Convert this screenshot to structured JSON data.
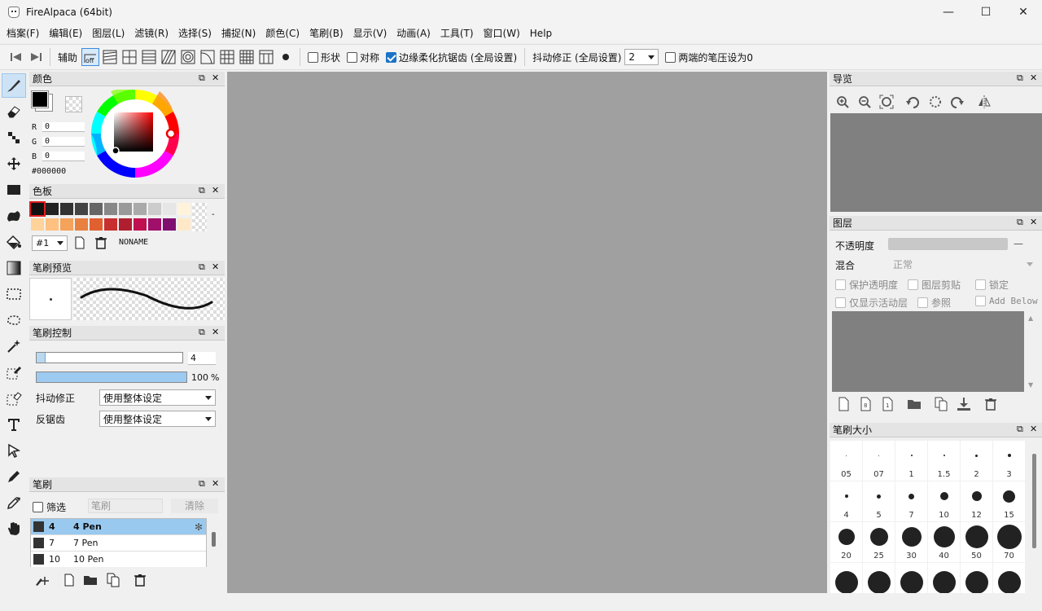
{
  "window": {
    "title": "FireAlpaca (64bit)",
    "minimize": "—",
    "maximize": "☐",
    "close": "✕"
  },
  "menu": [
    "档案(F)",
    "编辑(E)",
    "图层(L)",
    "滤镜(R)",
    "选择(S)",
    "捕捉(N)",
    "颜色(C)",
    "笔刷(B)",
    "显示(V)",
    "动画(A)",
    "工具(T)",
    "窗口(W)",
    "Help"
  ],
  "toolbar": {
    "assist_label": "辅助",
    "snap_off_label": "off",
    "shape_label": "形状",
    "symmetry_label": "对称",
    "antialias_label": "边缘柔化抗锯齿 (全局设置)",
    "antialias_checked": true,
    "stabilizer_label": "抖动修正 (全局设置)",
    "stabilizer_value": "2",
    "pressure_label": "两端的笔压设为0"
  },
  "color_panel": {
    "title": "颜色",
    "r_label": "R",
    "r_value": "0",
    "g_label": "G",
    "g_value": "0",
    "b_label": "B",
    "b_value": "0",
    "hex": "#000000"
  },
  "palette_panel": {
    "title": "色板",
    "palette_select": "#1",
    "palette_name": "NONAME",
    "row1": [
      "#111111",
      "#222222",
      "#333333",
      "#444444",
      "#666666",
      "#888888",
      "#999999",
      "#aaaaaa",
      "#cccccc",
      "#e6e6e6",
      "#fff3dc"
    ],
    "row2": [
      "#ffd39a",
      "#ffc080",
      "#f5a25a",
      "#e88040",
      "#e06030",
      "#c83030",
      "#b01f30",
      "#c01050",
      "#a0106a",
      "#801070",
      "#ffe8c8"
    ],
    "dash": "-"
  },
  "brush_preview_panel": {
    "title": "笔刷预览"
  },
  "brush_control_panel": {
    "title": "笔刷控制",
    "size_value": "4",
    "opacity_value": "100",
    "opacity_unit": "%",
    "size_fraction": 0.06,
    "opacity_fraction": 1.0,
    "stabilizer_label": "抖动修正",
    "stabilizer_value": "使用整体设定",
    "antialias_label": "反锯齿",
    "antialias_value": "使用整体设定"
  },
  "brush_panel": {
    "title": "笔刷",
    "filter_label": "筛选",
    "filter_placeholder": "笔刷",
    "clear_label": "清除",
    "items": [
      {
        "size": "4",
        "name": "4 Pen",
        "selected": true
      },
      {
        "size": "7",
        "name": "7 Pen",
        "selected": false
      },
      {
        "size": "10",
        "name": "10 Pen",
        "selected": false
      }
    ]
  },
  "navigator_panel": {
    "title": "导览"
  },
  "layer_panel": {
    "title": "图层",
    "opacity_label": "不透明度",
    "opacity_value": "—",
    "blend_label": "混合",
    "blend_value": "正常",
    "protect_alpha": "保护透明度",
    "clipping": "图层剪贴",
    "lock": "锁定",
    "show_active_only": "仅显示活动层",
    "reference": "参照",
    "add_below": "Add Below"
  },
  "brush_size_panel": {
    "title": "笔刷大小",
    "sizes": [
      "05",
      "07",
      "1",
      "1.5",
      "2",
      "3",
      "4",
      "5",
      "7",
      "10",
      "12",
      "15",
      "20",
      "25",
      "30",
      "40",
      "50",
      "70",
      "",
      "",
      "",
      "",
      "",
      ""
    ]
  },
  "colors": {
    "accent": "#1a73c8",
    "selection": "#99c9ef",
    "canvas_bg": "#a0a0a0",
    "panel_gray": "#808080"
  }
}
